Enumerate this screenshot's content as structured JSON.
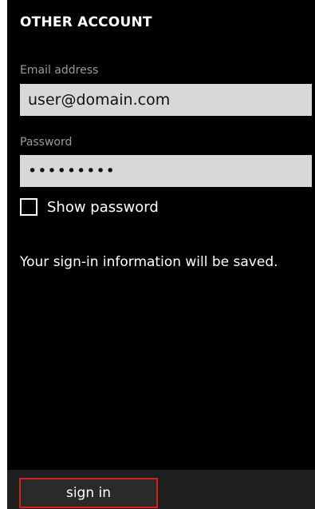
{
  "header": {
    "title": "OTHER ACCOUNT"
  },
  "form": {
    "email_label": "Email address",
    "email_value": "user@domain.com",
    "password_label": "Password",
    "password_value": "•••••••••",
    "show_password_label": "Show password",
    "show_password_checked": false,
    "info_text": "Your sign-in information will be saved."
  },
  "appbar": {
    "sign_in_label": "sign in"
  },
  "colors": {
    "background": "#000000",
    "textbox": "#d8d8d8",
    "label": "#9a9a9a",
    "highlight_border": "#d0231b"
  }
}
